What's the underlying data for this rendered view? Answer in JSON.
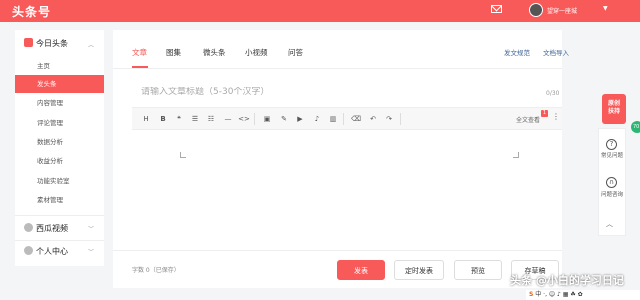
{
  "header": {
    "logo": "头条号",
    "username": "望穿一座城",
    "caret": "▼"
  },
  "sidebar": {
    "section1": "今日头条",
    "items": [
      "主页",
      "发头条",
      "内容管理",
      "评论管理",
      "数据分析",
      "收益分析",
      "功能实验室",
      "素材管理"
    ],
    "section2": "西瓜视频",
    "section3": "个人中心",
    "caret_up": "︿",
    "caret_down": "﹀"
  },
  "tabs": [
    "文章",
    "图集",
    "微头条",
    "小视频",
    "问答"
  ],
  "links": {
    "guide": "发文规范",
    "import": "文档导入"
  },
  "editor": {
    "title_placeholder": "请输入文章标题（5-30个汉字）",
    "counter": "0/30",
    "toolbar_right": "全文查看",
    "badge": "1",
    "toolbar_icons": [
      "H",
      "B",
      "❝",
      "☰",
      "☷",
      "—",
      "<>",
      "▣",
      "✎",
      "▶",
      "♪",
      "▥",
      "⌫",
      "↶",
      "↷"
    ]
  },
  "footer": {
    "word_count": "字数 0（已保存）",
    "publish": "发表",
    "scheduled": "定时发表",
    "preview": "预览",
    "save_draft": "存草稿"
  },
  "right_panel": {
    "promo": [
      "原创",
      "扶持"
    ],
    "faq": "常见问题",
    "ask": "问题咨询",
    "top_caret": "︿"
  },
  "badge_green": "70",
  "watermark": "头条 @小白的学习日记",
  "ime": "中 ·, ☺ ♪ ▦ ☘ ✿"
}
